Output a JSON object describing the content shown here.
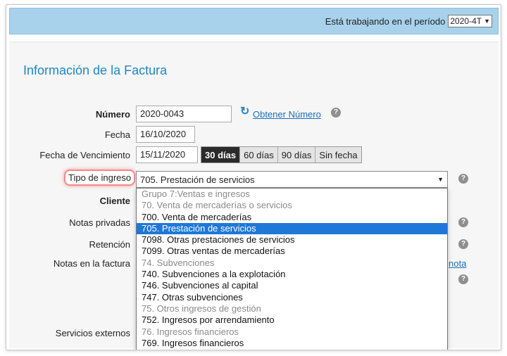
{
  "header": {
    "period_text": "Está trabajando en el período",
    "period_value": "2020-4T"
  },
  "form": {
    "title": "Información de la Factura",
    "numero_label": "Número",
    "numero_value": "2020-0043",
    "obtener_label": "Obtener Número",
    "fecha_label": "Fecha",
    "fecha_value": "16/10/2020",
    "vencimiento_label": "Fecha de Vencimiento",
    "vencimiento_value": "15/11/2020",
    "plazos": [
      "30 días",
      "60 días",
      "90 días",
      "Sin fecha"
    ],
    "tipo_label": "Tipo de ingreso",
    "tipo_value": "705. Prestación de servicios",
    "cliente_label": "Cliente",
    "notas_privadas_label": "Notas privadas",
    "retencion_label": "Retención",
    "notas_factura_label": "Notas en la factura",
    "nota_link": "nota",
    "servicios_label": "Servicios externos"
  },
  "dropdown": {
    "options": [
      {
        "label": "Grupo 7:Ventas e ingresos",
        "type": "group"
      },
      {
        "label": "70. Venta de mercaderías o servicios",
        "type": "group"
      },
      {
        "label": "700. Venta de mercaderías",
        "type": "option"
      },
      {
        "label": "705. Prestación de servicios",
        "type": "selected"
      },
      {
        "label": "7098. Otras prestaciones de servicios",
        "type": "option"
      },
      {
        "label": "7099. Otras ventas de mercaderías",
        "type": "option"
      },
      {
        "label": "74. Subvenciones",
        "type": "group"
      },
      {
        "label": "740. Subvenciones a la explotación",
        "type": "option"
      },
      {
        "label": "746. Subvenciones al capital",
        "type": "option"
      },
      {
        "label": "747. Otras subvenciones",
        "type": "option"
      },
      {
        "label": "75. Otros ingresos de gestión",
        "type": "group"
      },
      {
        "label": "752. Ingresos por arrendamiento",
        "type": "option"
      },
      {
        "label": "76. Ingresos financieros",
        "type": "group"
      },
      {
        "label": "769. Ingresos financieros",
        "type": "option"
      }
    ]
  },
  "colors": {
    "accent": "#1f86c6",
    "header_bg": "#a8d2ec",
    "selected_bg": "#1e78d8",
    "highlight": "#f28a8a"
  }
}
